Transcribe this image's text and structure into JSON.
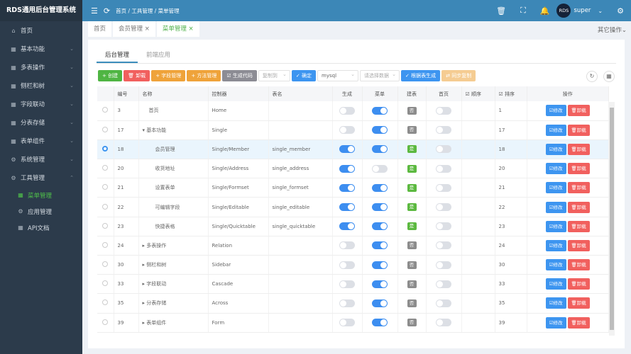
{
  "app_title": "RDS通用后台管理系统",
  "sidebar": {
    "items": [
      {
        "label": "首页",
        "icon": "home-icon",
        "glyph": "⌂",
        "chevron": ""
      },
      {
        "label": "基本功能",
        "icon": "grid-icon",
        "glyph": "▦",
        "chevron": "⌄"
      },
      {
        "label": "多表操作",
        "icon": "grid-icon",
        "glyph": "▦",
        "chevron": "⌄"
      },
      {
        "label": "侧栏和树",
        "icon": "grid-icon",
        "glyph": "▦",
        "chevron": "⌄"
      },
      {
        "label": "字段联动",
        "icon": "grid-icon",
        "glyph": "▦",
        "chevron": "⌄"
      },
      {
        "label": "分表存储",
        "icon": "grid-icon",
        "glyph": "▦",
        "chevron": "⌄"
      },
      {
        "label": "表单组件",
        "icon": "grid-icon",
        "glyph": "▦",
        "chevron": "⌄"
      },
      {
        "label": "系统管理",
        "icon": "gear-icon",
        "glyph": "⚙",
        "chevron": "⌄"
      },
      {
        "label": "工具管理",
        "icon": "gear-icon",
        "glyph": "⚙",
        "chevron": "⌃"
      }
    ],
    "subitems": [
      {
        "label": "菜单管理",
        "icon": "grid-icon",
        "glyph": "▦",
        "active": true
      },
      {
        "label": "应用管理",
        "icon": "gear-icon",
        "glyph": "⚙",
        "active": false
      },
      {
        "label": "API文档",
        "icon": "grid-icon",
        "glyph": "▦",
        "active": false
      }
    ]
  },
  "header": {
    "breadcrumb": "首页 / 工具管理 / 菜单管理",
    "user": "super",
    "avatar_text": "RDS"
  },
  "tabs": [
    {
      "label": "首页",
      "closable": false
    },
    {
      "label": "会员管理 ×",
      "closable": true
    },
    {
      "label": "菜单管理 ×",
      "closable": true,
      "active": true
    }
  ],
  "other_ops": "其它操作⌄",
  "page_tabs": [
    "后台管理",
    "前端应用"
  ],
  "toolbar": {
    "create": "+ 创建",
    "uninstall": "🗑 卸载",
    "field": "+ 字段管理",
    "method": "+ 方法管理",
    "gencode": "☑ 生成代码",
    "copy_to": "复制到",
    "confirm": "✓ 确定",
    "db": "mysql",
    "table_select": "请选择数据",
    "gen_by_table": "✓ 根据表生成",
    "sync": "⇄ 同步复制"
  },
  "columns": [
    "",
    "编号",
    "名称",
    "控制器",
    "表名",
    "生成",
    "菜单",
    "建表",
    "首页",
    "☑ 顺序",
    "☑ 排序",
    "操作"
  ],
  "row_actions": {
    "edit": "☑修改",
    "uninstall": "🗑卸载"
  },
  "badges": {
    "yes": "是",
    "no": "否"
  },
  "rows": [
    {
      "id": "3",
      "name": "首页",
      "prefix": "",
      "indent": 1,
      "ctrl": "Home",
      "table": "",
      "gen": false,
      "menu": true,
      "built": false,
      "home": false,
      "sort": "1"
    },
    {
      "id": "17",
      "name": "基本功能",
      "prefix": "▾ ",
      "indent": 0,
      "ctrl": "Single",
      "table": "",
      "gen": false,
      "menu": true,
      "built": false,
      "home": false,
      "sort": "17"
    },
    {
      "id": "18",
      "name": "会员管理",
      "prefix": "",
      "indent": 2,
      "ctrl": "Single/Member",
      "table": "single_member",
      "gen": true,
      "menu": true,
      "built": true,
      "home": false,
      "sort": "18",
      "selected": true
    },
    {
      "id": "20",
      "name": "收货地址",
      "prefix": "",
      "indent": 2,
      "ctrl": "Single/Address",
      "table": "single_address",
      "gen": true,
      "menu": false,
      "built": true,
      "home": false,
      "sort": "20"
    },
    {
      "id": "21",
      "name": "设置表单",
      "prefix": "",
      "indent": 2,
      "ctrl": "Single/Formset",
      "table": "single_formset",
      "gen": true,
      "menu": true,
      "built": true,
      "home": false,
      "sort": "21"
    },
    {
      "id": "22",
      "name": "可编辑字段",
      "prefix": "",
      "indent": 2,
      "ctrl": "Single/Editable",
      "table": "single_editable",
      "gen": true,
      "menu": true,
      "built": true,
      "home": false,
      "sort": "22"
    },
    {
      "id": "23",
      "name": "快捷表格",
      "prefix": "",
      "indent": 2,
      "ctrl": "Single/Quicktable",
      "table": "single_quicktable",
      "gen": true,
      "menu": true,
      "built": true,
      "home": false,
      "sort": "23"
    },
    {
      "id": "24",
      "name": "多表操作",
      "prefix": "▸ ",
      "indent": 0,
      "ctrl": "Relation",
      "table": "",
      "gen": false,
      "menu": true,
      "built": false,
      "home": false,
      "sort": "24"
    },
    {
      "id": "30",
      "name": "侧栏和树",
      "prefix": "▸ ",
      "indent": 0,
      "ctrl": "Sidebar",
      "table": "",
      "gen": false,
      "menu": true,
      "built": false,
      "home": false,
      "sort": "30"
    },
    {
      "id": "33",
      "name": "字段联动",
      "prefix": "▸ ",
      "indent": 0,
      "ctrl": "Cascade",
      "table": "",
      "gen": false,
      "menu": true,
      "built": false,
      "home": false,
      "sort": "33"
    },
    {
      "id": "35",
      "name": "分表存储",
      "prefix": "▸ ",
      "indent": 0,
      "ctrl": "Across",
      "table": "",
      "gen": false,
      "menu": true,
      "built": false,
      "home": false,
      "sort": "35"
    },
    {
      "id": "39",
      "name": "表单组件",
      "prefix": "▸ ",
      "indent": 0,
      "ctrl": "Form",
      "table": "",
      "gen": false,
      "menu": true,
      "built": false,
      "home": false,
      "sort": "39"
    }
  ]
}
